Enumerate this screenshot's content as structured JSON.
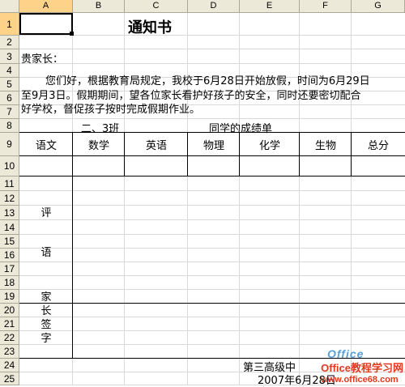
{
  "columns": [
    "A",
    "B",
    "C",
    "D",
    "E",
    "F",
    "G"
  ],
  "rows": [
    "1",
    "2",
    "3",
    "4",
    "5",
    "6",
    "7",
    "8",
    "9",
    "10",
    "11",
    "12",
    "13",
    "14",
    "15",
    "16",
    "17",
    "18",
    "19",
    "20",
    "21",
    "22",
    "23",
    "24",
    "25"
  ],
  "title": "通知书",
  "greeting": "贵家长：",
  "body_lines": [
    "您们好，根据教育局规定，我校于6月28日开始放假，时间为6月29日",
    "至9月3日。假期期间，望各位家长看护好孩子的安全，同时还要密切配合",
    "好学校，督促孩子按时完成假期作业。"
  ],
  "class_label": "二、3班",
  "report_title": "同学的成绩单",
  "subjects": [
    "语文",
    "数学",
    "英语",
    "物理",
    "化学",
    "生物",
    "总分"
  ],
  "comment_label": [
    "评",
    "语"
  ],
  "parent_sign_label": [
    "家",
    "长",
    "签",
    "字"
  ],
  "school_name": "第三高级中",
  "date": "2007年6月28日",
  "watermark": {
    "logo_text": "Office",
    "text_prefix": "Office",
    "text_cn": "教程学习网",
    "url": "www.office68.com",
    "color": "#e03a1e"
  }
}
